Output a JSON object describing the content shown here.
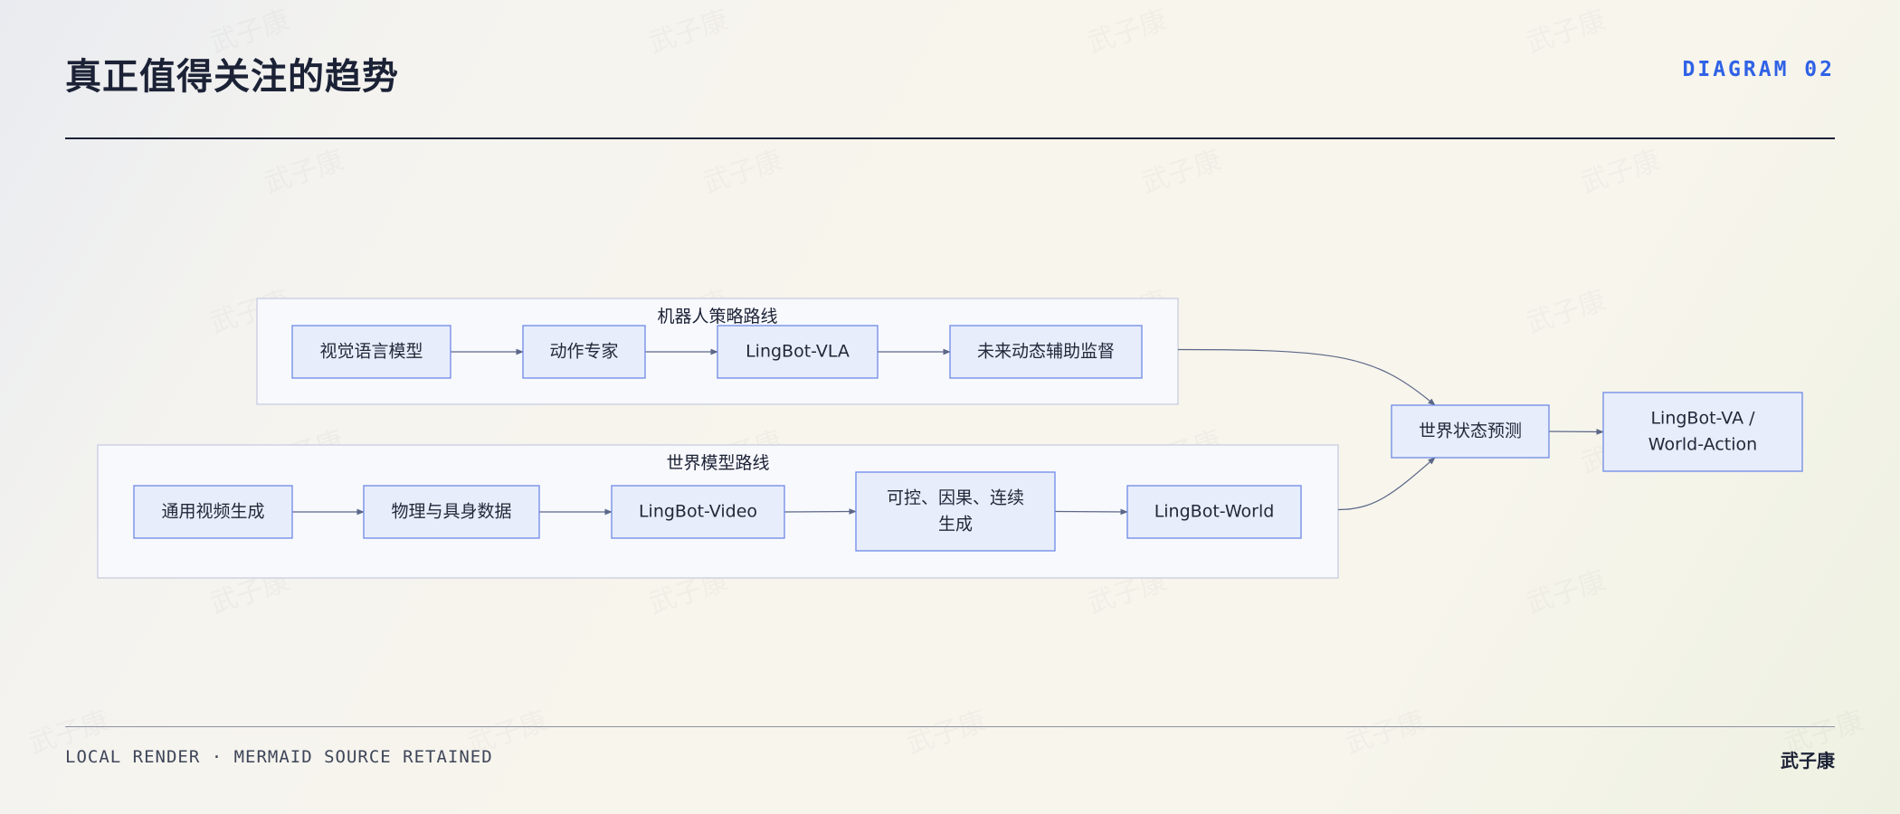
{
  "header": {
    "title": "真正值得关注的趋势",
    "tag": "DIAGRAM 02"
  },
  "watermark": "武子康",
  "diagram": {
    "clusters": [
      {
        "id": "robot",
        "label": "机器人策略路线"
      },
      {
        "id": "world",
        "label": "世界模型路线"
      }
    ],
    "nodes": [
      {
        "id": "vlm",
        "cluster": "robot",
        "lines": [
          "视觉语言模型"
        ]
      },
      {
        "id": "action-expert",
        "cluster": "robot",
        "lines": [
          "动作专家"
        ]
      },
      {
        "id": "lingbot-vla",
        "cluster": "robot",
        "lines": [
          "LingBot-VLA"
        ]
      },
      {
        "id": "future-dynamics",
        "cluster": "robot",
        "lines": [
          "未来动态辅助监督"
        ]
      },
      {
        "id": "video-gen",
        "cluster": "world",
        "lines": [
          "通用视频生成"
        ]
      },
      {
        "id": "physics-data",
        "cluster": "world",
        "lines": [
          "物理与具身数据"
        ]
      },
      {
        "id": "lingbot-video",
        "cluster": "world",
        "lines": [
          "LingBot-Video"
        ]
      },
      {
        "id": "controllable-gen",
        "cluster": "world",
        "lines": [
          "可控、因果、连续",
          "生成"
        ]
      },
      {
        "id": "lingbot-world",
        "cluster": "world",
        "lines": [
          "LingBot-World"
        ]
      },
      {
        "id": "world-state",
        "cluster": null,
        "lines": [
          "世界状态预测"
        ]
      },
      {
        "id": "lingbot-va",
        "cluster": null,
        "lines": [
          "LingBot-VA /",
          "World-Action"
        ]
      }
    ],
    "edges": [
      {
        "from": "vlm",
        "to": "action-expert"
      },
      {
        "from": "action-expert",
        "to": "lingbot-vla"
      },
      {
        "from": "lingbot-vla",
        "to": "future-dynamics"
      },
      {
        "from": "video-gen",
        "to": "physics-data"
      },
      {
        "from": "physics-data",
        "to": "lingbot-video"
      },
      {
        "from": "lingbot-video",
        "to": "controllable-gen"
      },
      {
        "from": "controllable-gen",
        "to": "lingbot-world"
      },
      {
        "from": "robot",
        "to": "world-state"
      },
      {
        "from": "world",
        "to": "world-state"
      },
      {
        "from": "world-state",
        "to": "lingbot-va"
      }
    ]
  },
  "footer": {
    "note": "LOCAL RENDER · MERMAID SOURCE RETAINED",
    "author": "武子康"
  }
}
